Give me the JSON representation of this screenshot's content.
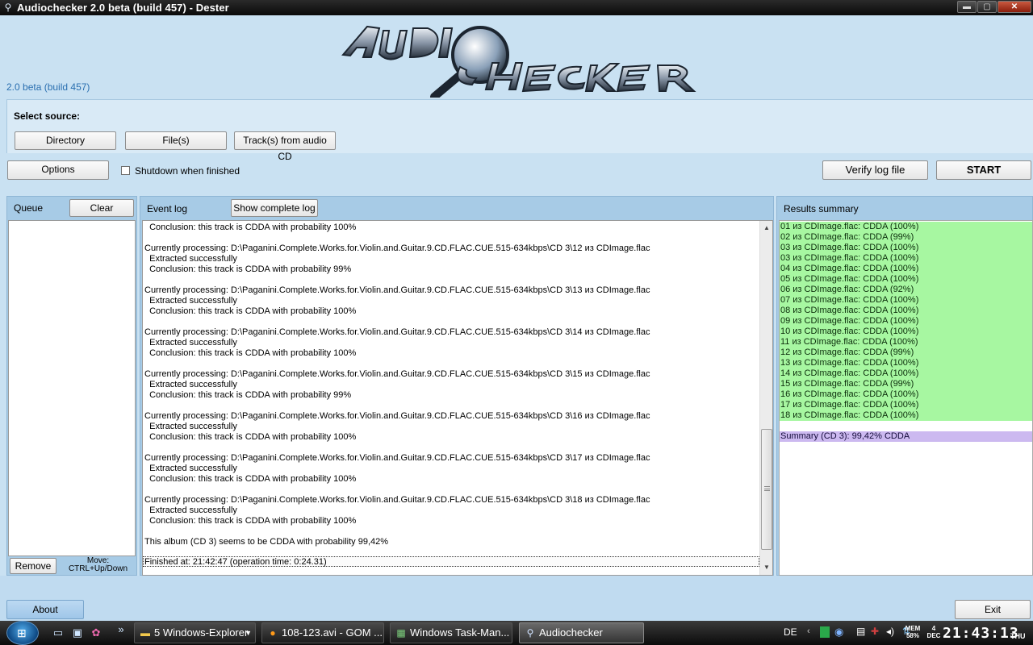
{
  "window": {
    "title": "Audiochecker 2.0 beta (build 457) - Dester",
    "version_label": "2.0 beta (build 457)",
    "minimize": "▬",
    "maximize": "▢",
    "close": "✕"
  },
  "source": {
    "label": "Select source:",
    "directory_button": "Directory",
    "files_button": "File(s)",
    "cd_button": "Track(s) from audio CD"
  },
  "controls": {
    "options_button": "Options",
    "shutdown_label": "Shutdown when finished",
    "shutdown_checked": false,
    "verify_button": "Verify log file",
    "start_button": "START"
  },
  "queue": {
    "title": "Queue",
    "clear_button": "Clear",
    "remove_button": "Remove",
    "move_hint_line1": "Move:",
    "move_hint_line2": "CTRL+Up/Down"
  },
  "event_log": {
    "title": "Event log",
    "show_complete_button": "Show complete log",
    "lines": [
      "  Conclusion: this track is CDDA with probability 100%",
      "",
      "Currently processing: D:\\Paganini.Complete.Works.for.Violin.and.Guitar.9.CD.FLAC.CUE.515-634kbps\\CD 3\\12 из CDImage.flac",
      "  Extracted successfully",
      "  Conclusion: this track is CDDA with probability 99%",
      "",
      "Currently processing: D:\\Paganini.Complete.Works.for.Violin.and.Guitar.9.CD.FLAC.CUE.515-634kbps\\CD 3\\13 из CDImage.flac",
      "  Extracted successfully",
      "  Conclusion: this track is CDDA with probability 100%",
      "",
      "Currently processing: D:\\Paganini.Complete.Works.for.Violin.and.Guitar.9.CD.FLAC.CUE.515-634kbps\\CD 3\\14 из CDImage.flac",
      "  Extracted successfully",
      "  Conclusion: this track is CDDA with probability 100%",
      "",
      "Currently processing: D:\\Paganini.Complete.Works.for.Violin.and.Guitar.9.CD.FLAC.CUE.515-634kbps\\CD 3\\15 из CDImage.flac",
      "  Extracted successfully",
      "  Conclusion: this track is CDDA with probability 99%",
      "",
      "Currently processing: D:\\Paganini.Complete.Works.for.Violin.and.Guitar.9.CD.FLAC.CUE.515-634kbps\\CD 3\\16 из CDImage.flac",
      "  Extracted successfully",
      "  Conclusion: this track is CDDA with probability 100%",
      "",
      "Currently processing: D:\\Paganini.Complete.Works.for.Violin.and.Guitar.9.CD.FLAC.CUE.515-634kbps\\CD 3\\17 из CDImage.flac",
      "  Extracted successfully",
      "  Conclusion: this track is CDDA with probability 100%",
      "",
      "Currently processing: D:\\Paganini.Complete.Works.for.Violin.and.Guitar.9.CD.FLAC.CUE.515-634kbps\\CD 3\\18 из CDImage.flac",
      "  Extracted successfully",
      "  Conclusion: this track is CDDA with probability 100%",
      "",
      "This album (CD 3) seems to be CDDA with probability 99,42%",
      ""
    ],
    "finished_line": "Finished at: 21:42:47 (operation time: 0:24.31)"
  },
  "results": {
    "title": "Results summary",
    "rows": [
      "01 из CDImage.flac: CDDA (100%)",
      "02 из CDImage.flac: CDDA (99%)",
      "03 из CDImage.flac: CDDA (100%)",
      "03 из CDImage.flac: CDDA (100%)",
      "04 из CDImage.flac: CDDA (100%)",
      "05 из CDImage.flac: CDDA (100%)",
      "06 из CDImage.flac: CDDA (92%)",
      "07 из CDImage.flac: CDDA (100%)",
      "08 из CDImage.flac: CDDA (100%)",
      "09 из CDImage.flac: CDDA (100%)",
      "10 из CDImage.flac: CDDA (100%)",
      "11 из CDImage.flac: CDDA (100%)",
      "12 из CDImage.flac: CDDA (99%)",
      "13 из CDImage.flac: CDDA (100%)",
      "14 из CDImage.flac: CDDA (100%)",
      "15 из CDImage.flac: CDDA (99%)",
      "16 из CDImage.flac: CDDA (100%)",
      "17 из CDImage.flac: CDDA (100%)",
      "18 из CDImage.flac: CDDA (100%)"
    ],
    "summary": "Summary (CD 3): 99,42% CDDA"
  },
  "bottom": {
    "about_button": "About",
    "exit_button": "Exit"
  },
  "taskbar": {
    "tasks": [
      {
        "label": "5 Windows-Explorer",
        "icon": "folder-icon"
      },
      {
        "label": "108-123.avi - GOM ...",
        "icon": "gom-player-icon"
      },
      {
        "label": "Windows Task-Man...",
        "icon": "task-manager-icon"
      },
      {
        "label": "Audiochecker",
        "icon": "audiochecker-icon"
      }
    ],
    "overflow": "»",
    "language": "DE",
    "mem_label": "MEM",
    "mem_value": "58%",
    "date_day": "4",
    "date_month": "DEC",
    "time": "21:43:13",
    "weekday": "THU"
  },
  "colors": {
    "window_bg": "#c9e1f2",
    "result_ok": "#a7f7a1",
    "summary_bg": "#ccb9f0",
    "version_text": "#2a6fb0"
  }
}
